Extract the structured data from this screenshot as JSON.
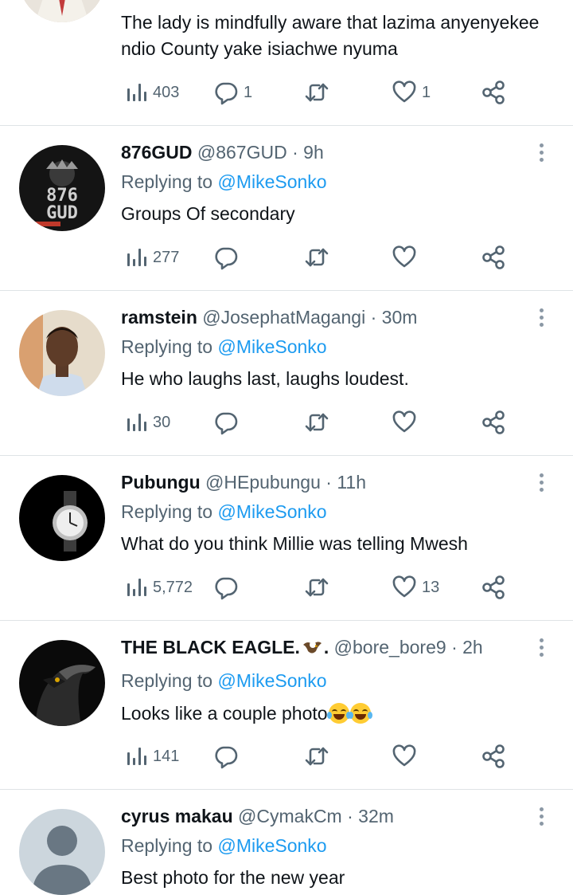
{
  "tweets": [
    {
      "name": "",
      "handle": "",
      "time": "",
      "replying_prefix": "",
      "replying_mention": "",
      "text": "The lady is mindfully aware that lazima anyenyekee ndio County yake isiachwe nyuma",
      "views": "403",
      "replies": "1",
      "retweets": "",
      "likes": "1"
    },
    {
      "name": "876GUD",
      "handle": "@867GUD",
      "time": "9h",
      "replying_prefix": "Replying to",
      "replying_mention": "@MikeSonko",
      "text": "Groups Of secondary",
      "views": "277",
      "replies": "",
      "retweets": "",
      "likes": "",
      "avatar_text": "876 GUD"
    },
    {
      "name": "ramstein",
      "handle": "@JosephatMagangi",
      "time": "30m",
      "replying_prefix": "Replying to",
      "replying_mention": "@MikeSonko",
      "text": "He who laughs last, laughs loudest.",
      "views": "30",
      "replies": "",
      "retweets": "",
      "likes": ""
    },
    {
      "name": "Pubungu",
      "handle": "@HEpubungu",
      "time": "11h",
      "replying_prefix": "Replying to",
      "replying_mention": "@MikeSonko",
      "text": "What do you think Millie was telling Mwesh",
      "views": "5,772",
      "replies": "",
      "retweets": "",
      "likes": "13"
    },
    {
      "name": "THE BLACK EAGLE.",
      "name_suffix": ".",
      "handle": "@bore_bore9",
      "time": "2h",
      "replying_prefix": "Replying to",
      "replying_mention": "@MikeSonko",
      "text": "Looks like a couple photo",
      "views": "141",
      "replies": "",
      "retweets": "",
      "likes": ""
    },
    {
      "name": "cyrus makau",
      "handle": "@CymakCm",
      "time": "32m",
      "replying_prefix": "Replying to",
      "replying_mention": "@MikeSonko",
      "text": "Best photo for the new year",
      "views": "",
      "replies": "",
      "retweets": "",
      "likes": ""
    }
  ],
  "separator": "·",
  "icons": {
    "views": "views-bar-chart-icon",
    "reply": "reply-bubble-icon",
    "retweet": "retweet-icon",
    "like": "heart-icon",
    "share": "share-icon",
    "more": "more-vertical-icon",
    "emoji": "face-with-tears-of-joy-emoji",
    "name_emoji": "eagle-emoji"
  },
  "colors": {
    "text_primary": "#0f1419",
    "text_secondary": "#536471",
    "mention": "#1d9bf0",
    "divider": "#dfe3e6"
  }
}
